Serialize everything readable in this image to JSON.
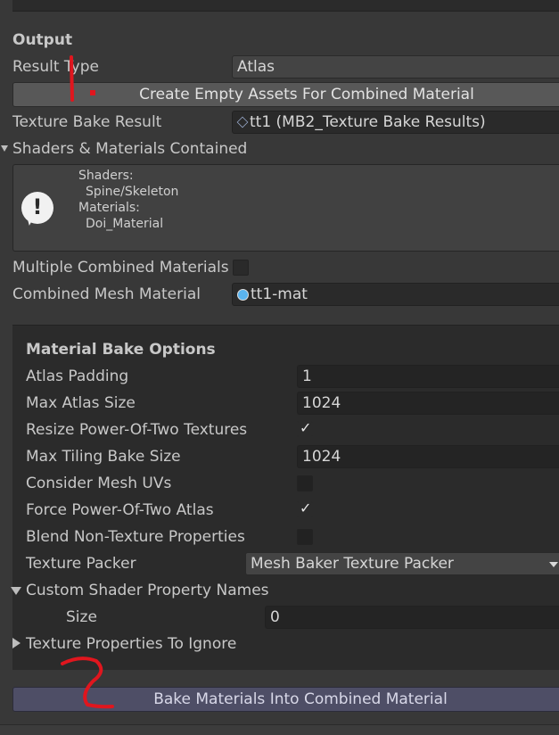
{
  "output": {
    "heading": "Output",
    "result_type_label": "Result Type",
    "result_type_value": "Atlas",
    "create_button_label": "Create Empty Assets For Combined Material",
    "texture_bake_result_label": "Texture Bake Result",
    "texture_bake_result_value": "tt1 (MB2_Texture Bake Results)",
    "shaders_foldout_label": "Shaders & Materials Contained",
    "info": {
      "shaders_label": "Shaders:",
      "shader_name": "Spine/Skeleton",
      "materials_label": "Materials:",
      "material_name": "Doi_Material"
    },
    "multiple_combined_label": "Multiple Combined Materials",
    "combined_mesh_material_label": "Combined Mesh Material",
    "combined_mesh_material_value": "tt1-mat"
  },
  "bake_options": {
    "heading": "Material Bake Options",
    "atlas_padding_label": "Atlas Padding",
    "atlas_padding_value": "1",
    "max_atlas_size_label": "Max Atlas Size",
    "max_atlas_size_value": "1024",
    "resize_pot_label": "Resize Power-Of-Two Textures",
    "resize_pot_checked": true,
    "max_tiling_label": "Max Tiling Bake Size",
    "max_tiling_value": "1024",
    "consider_uvs_label": "Consider Mesh UVs",
    "consider_uvs_checked": false,
    "force_pot_label": "Force Power-Of-Two Atlas",
    "force_pot_checked": true,
    "blend_label": "Blend Non-Texture Properties",
    "blend_checked": false,
    "packer_label": "Texture Packer",
    "packer_value": "Mesh Baker Texture Packer",
    "custom_shader_label": "Custom Shader Property Names",
    "size_label": "Size",
    "size_value": "0",
    "ignore_label": "Texture Properties To Ignore"
  },
  "bake_button_label": "Bake Materials Into Combined Material",
  "annotations": {
    "mark_1": "1",
    "mark_2": "2",
    "color": "#e0161e"
  },
  "colors": {
    "bg": "#383838",
    "panel": "#2b2b2b",
    "field": "#2a2a2a",
    "bake_button": "#4e4e66"
  }
}
